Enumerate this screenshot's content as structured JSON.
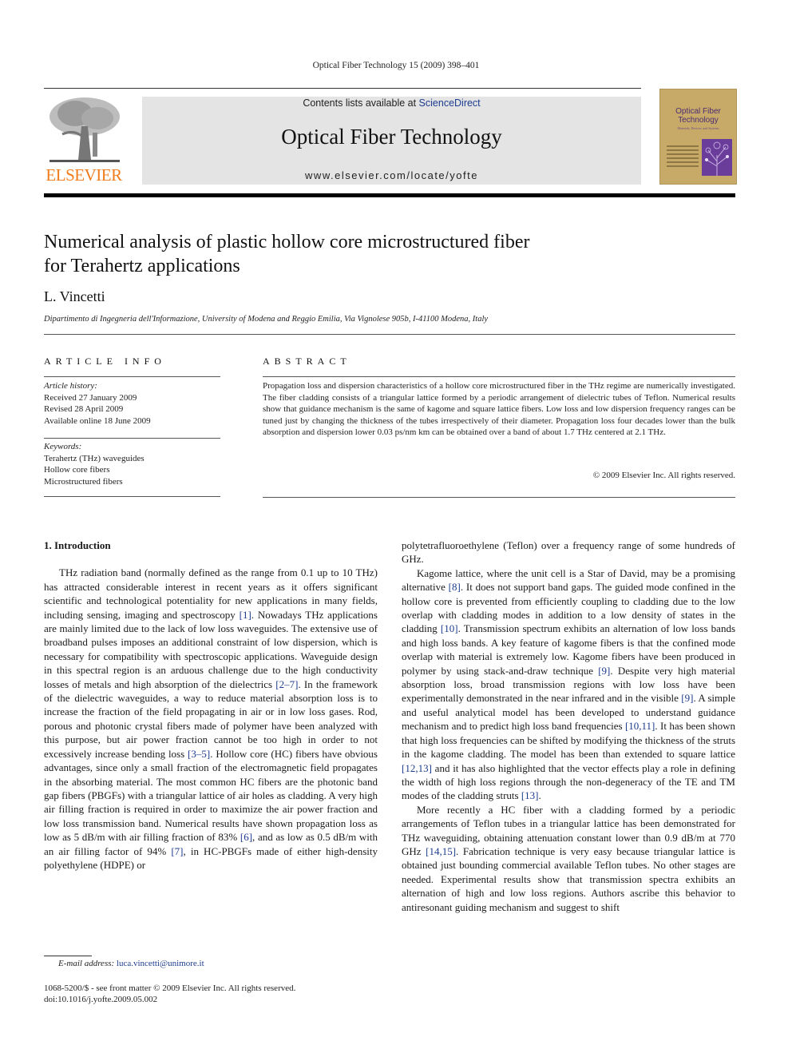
{
  "header": {
    "running_head": "Optical Fiber Technology 15 (2009) 398–401",
    "contents_prefix": "Contents lists available at ",
    "sciencedirect_link": "ScienceDirect",
    "journal_name": "Optical Fiber Technology",
    "journal_url": "www.elsevier.com/locate/yofte",
    "publisher_logo_text": "ELSEVIER",
    "cover_title_line1": "Optical Fiber",
    "cover_title_line2": "Technology",
    "cover_subtitle": "Materials, Devices, and Systems"
  },
  "colors": {
    "elsevier_orange": "#f07c1b",
    "link_blue": "#1d3c8f",
    "banner_gray": "#e4e4e4",
    "cover_gold": "#c8aa68",
    "cover_purple": "#6b3d9a"
  },
  "article": {
    "title_line1": "Numerical analysis of plastic hollow core microstructured fiber",
    "title_line2": "for Terahertz applications",
    "author": "L. Vincetti",
    "affiliation": "Dipartimento di Ingegneria dell'Informazione, University of Modena and Reggio Emilia, Via Vignolese 905b, I-41100 Modena, Italy"
  },
  "article_info": {
    "heading": "ARTICLE INFO",
    "history_label": "Article history:",
    "history": [
      "Received 27 January 2009",
      "Revised 28 April 2009",
      "Available online 18 June 2009"
    ],
    "keywords_label": "Keywords:",
    "keywords": [
      "Terahertz (THz) waveguides",
      "Hollow core fibers",
      "Microstructured fibers"
    ]
  },
  "abstract": {
    "heading": "ABSTRACT",
    "text": "Propagation loss and dispersion characteristics of a hollow core microstructured fiber in the THz regime are numerically investigated. The fiber cladding consists of a triangular lattice formed by a periodic arrangement of dielectric tubes of Teflon. Numerical results show that guidance mechanism is the same of kagome and square lattice fibers. Low loss and low dispersion frequency ranges can be tuned just by changing the thickness of the tubes irrespectively of their diameter. Propagation loss four decades lower than the bulk absorption and dispersion lower 0.03 ps/nm km can be obtained over a band of about 1.7 THz centered at 2.1 THz.",
    "copyright": "© 2009 Elsevier Inc. All rights reserved."
  },
  "body": {
    "section1_heading": "1. Introduction",
    "left_p1": [
      "THz radiation band (normally defined as the range from 0.1 up to 10 THz) has attracted considerable interest in recent years as it offers significant scientific and technological potentiality for new applications in many fields, including sensing, imaging and spectroscopy ",
      "[1]",
      ". Nowadays THz applications are mainly limited due to the lack of low loss waveguides. The extensive use of broadband pulses imposes an additional constraint of low dispersion, which is necessary for compatibility with spectroscopic applications. Waveguide design in this spectral region is an arduous challenge due to the high conductivity losses of metals and high absorption of the dielectrics ",
      "[2–7]",
      ". In the framework of the dielectric waveguides, a way to reduce material absorption loss is to increase the fraction of the field propagating in air or in low loss gases. Rod, porous and photonic crystal fibers made of polymer have been analyzed with this purpose, but air power fraction cannot be too high in order to not excessively increase bending loss ",
      "[3–5]",
      ". Hollow core (HC) fibers have obvious advantages, since only a small fraction of the electromagnetic field propagates in the absorbing material. The most common HC fibers are the photonic band gap fibers (PBGFs) with a triangular lattice of air holes as cladding. A very high air filling fraction is required in order to maximize the air power fraction and low loss transmission band. Numerical results have shown propagation loss as low as 5 dB/m with air filling fraction of 83% ",
      "[6]",
      ", and as low as 0.5 dB/m with an air filling factor of 94% ",
      "[7]",
      ", in HC-PBGFs made of either high-density polyethylene (HDPE) or"
    ],
    "right_p0": "polytetrafluoroethylene (Teflon) over a frequency range of some hundreds of GHz.",
    "right_p1": [
      "Kagome lattice, where the unit cell is a Star of David, may be a promising alternative ",
      "[8]",
      ". It does not support band gaps. The guided mode confined in the hollow core is prevented from efficiently coupling to cladding due to the low overlap with cladding modes in addition to a low density of states in the cladding ",
      "[10]",
      ". Transmission spectrum exhibits an alternation of low loss bands and high loss bands. A key feature of kagome fibers is that the confined mode overlap with material is extremely low. Kagome fibers have been produced in polymer by using stack-and-draw technique ",
      "[9]",
      ". Despite very high material absorption loss, broad transmission regions with low loss have been experimentally demonstrated in the near infrared and in the visible ",
      "[9]",
      ". A simple and useful analytical model has been developed to understand guidance mechanism and to predict high loss band frequencies ",
      "[10,11]",
      ". It has been shown that high loss frequencies can be shifted by modifying the thickness of the struts in the kagome cladding. The model has been than extended to square lattice ",
      "[12,13]",
      " and it has also highlighted that the vector effects play a role in defining the width of high loss regions through the non-degeneracy of the TE and TM modes of the cladding struts ",
      "[13]",
      "."
    ],
    "right_p2": [
      "More recently a HC fiber with a cladding formed by a periodic arrangements of Teflon tubes in a triangular lattice has been demonstrated for THz waveguiding, obtaining attenuation constant lower than 0.9 dB/m at 770 GHz ",
      "[14,15]",
      ". Fabrication technique is very easy because triangular lattice is obtained just bounding commercial available Teflon tubes. No other stages are needed. Experimental results show that transmission spectra exhibits an alternation of high and low loss regions. Authors ascribe this behavior to antiresonant guiding mechanism and suggest to shift"
    ]
  },
  "footer": {
    "email_label": "E-mail address:",
    "email": "luca.vincetti@unimore.it",
    "front_matter": "1068-5200/$ - see front matter © 2009 Elsevier Inc. All rights reserved.",
    "doi": "doi:10.1016/j.yofte.2009.05.002"
  }
}
